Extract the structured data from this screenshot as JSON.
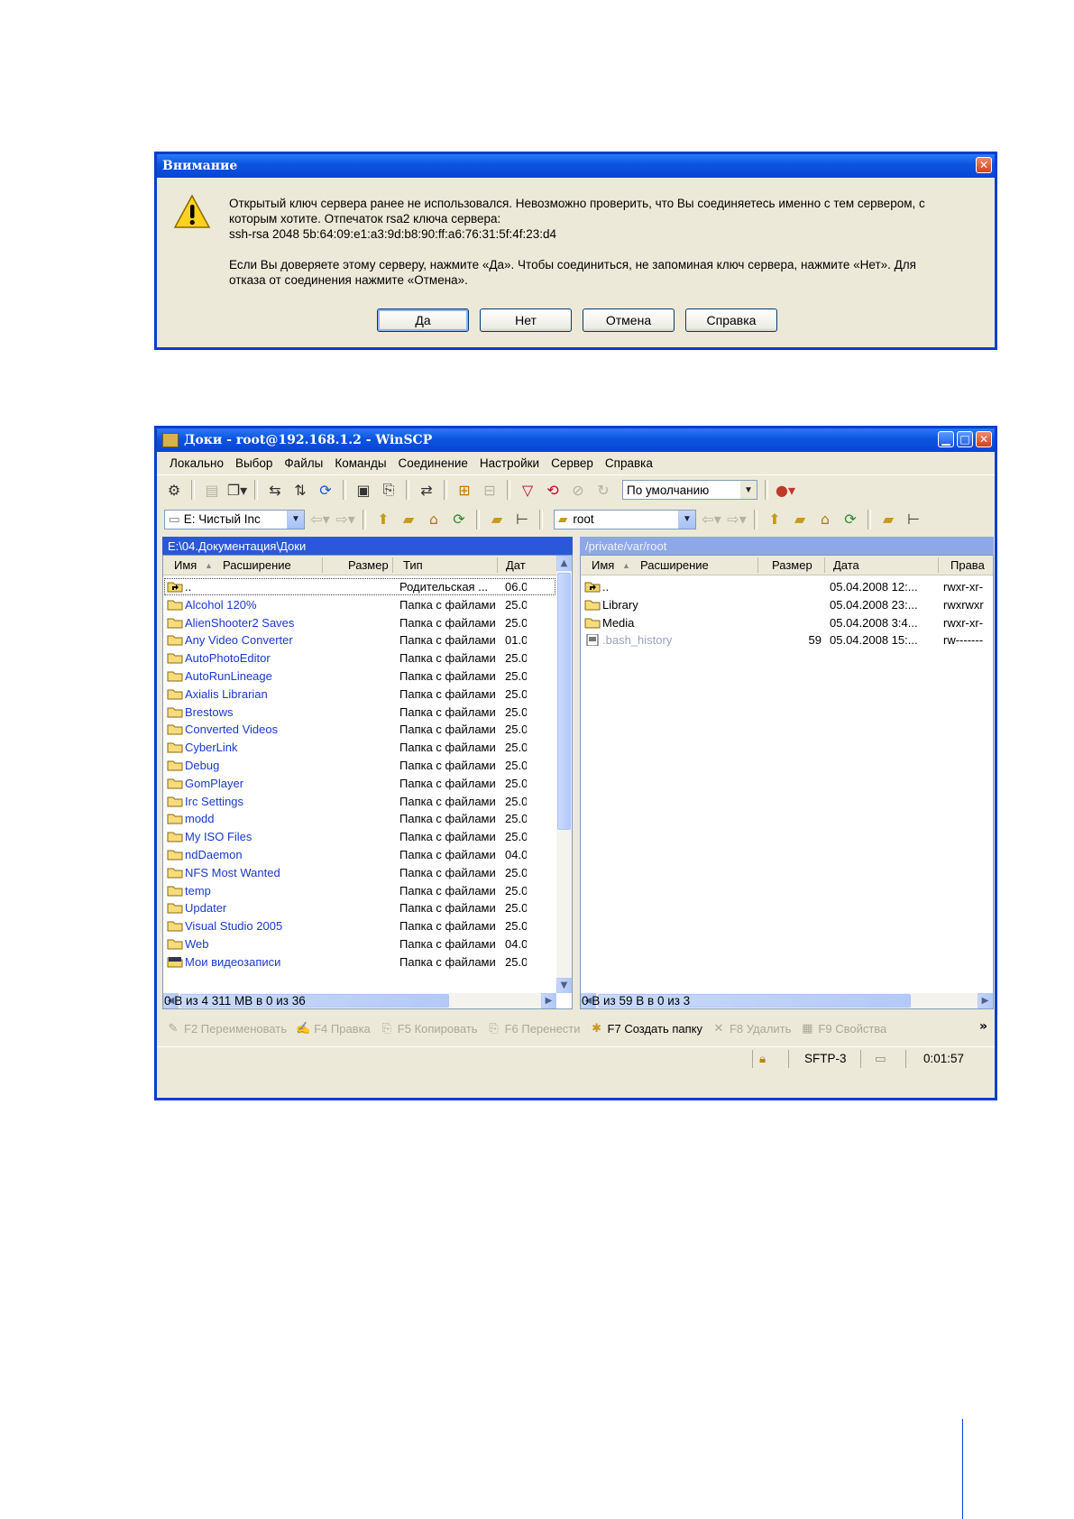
{
  "dialog": {
    "title": "Внимание",
    "message_line1": "Открытый ключ сервера ранее не использовался. Невозможно проверить, что Вы соединяетесь именно с тем сервером, с",
    "message_line2": "которым хотите. Отпечаток rsa2 ключа сервера:",
    "message_line3": "ssh-rsa 2048 5b:64:09:e1:a3:9d:b8:90:ff:a6:76:31:5f:4f:23:d4",
    "message_line4": "Если Вы доверяете этому серверу, нажмите «Да». Чтобы соединиться, не запоминая ключ сервера, нажмите «Нет». Для",
    "message_line5": "отказа от соединения нажмите «Отмена».",
    "buttons": [
      "Да",
      "Нет",
      "Отмена",
      "Справка"
    ]
  },
  "main": {
    "title": "Доки - root@192.168.1.2 - WinSCP",
    "menu": [
      "Локально",
      "Выбор",
      "Файлы",
      "Команды",
      "Соединение",
      "Настройки",
      "Сервер",
      "Справка"
    ],
    "preset_combo": "По умолчанию",
    "left_drive": "E: Чистый Inc",
    "remote_dir_combo": "root",
    "left_path": "E:\\04.Документация\\Доки",
    "right_path": "/private/var/root",
    "left_columns": [
      "Имя",
      "Расширение",
      "Размер",
      "Тип",
      "Дат"
    ],
    "right_columns": [
      "Имя",
      "Расширение",
      "Размер",
      "Дата",
      "Права"
    ],
    "left_files": [
      {
        "name": "..",
        "type": "Родительская ...",
        "date": "06.0"
      },
      {
        "name": "Alcohol 120%",
        "type": "Папка с файлами",
        "date": "25.0"
      },
      {
        "name": "AlienShooter2 Saves",
        "type": "Папка с файлами",
        "date": "25.0"
      },
      {
        "name": "Any Video Converter",
        "type": "Папка с файлами",
        "date": "01.0"
      },
      {
        "name": "AutoPhotoEditor",
        "type": "Папка с файлами",
        "date": "25.0"
      },
      {
        "name": "AutoRunLineage",
        "type": "Папка с файлами",
        "date": "25.0"
      },
      {
        "name": "Axialis Librarian",
        "type": "Папка с файлами",
        "date": "25.0"
      },
      {
        "name": "Brestows",
        "type": "Папка с файлами",
        "date": "25.0"
      },
      {
        "name": "Converted Videos",
        "type": "Папка с файлами",
        "date": "25.0"
      },
      {
        "name": "CyberLink",
        "type": "Папка с файлами",
        "date": "25.0"
      },
      {
        "name": "Debug",
        "type": "Папка с файлами",
        "date": "25.0"
      },
      {
        "name": "GomPlayer",
        "type": "Папка с файлами",
        "date": "25.0"
      },
      {
        "name": "Irc Settings",
        "type": "Папка с файлами",
        "date": "25.0"
      },
      {
        "name": "modd",
        "type": "Папка с файлами",
        "date": "25.0"
      },
      {
        "name": "My ISO Files",
        "type": "Папка с файлами",
        "date": "25.0"
      },
      {
        "name": "ndDaemon",
        "type": "Папка с файлами",
        "date": "04.0"
      },
      {
        "name": "NFS Most Wanted",
        "type": "Папка с файлами",
        "date": "25.0"
      },
      {
        "name": "temp",
        "type": "Папка с файлами",
        "date": "25.0"
      },
      {
        "name": "Updater",
        "type": "Папка с файлами",
        "date": "25.0"
      },
      {
        "name": "Visual Studio 2005",
        "type": "Папка с файлами",
        "date": "25.0"
      },
      {
        "name": "Web",
        "type": "Папка с файлами",
        "date": "04.0"
      },
      {
        "name": "Мои видеозаписи",
        "type": "Папка с файлами",
        "date": "25.0"
      }
    ],
    "right_files": [
      {
        "name": "..",
        "size": "",
        "date": "05.04.2008 12:...",
        "rights": "rwxr-xr-"
      },
      {
        "name": "Library",
        "size": "",
        "date": "05.04.2008 23:...",
        "rights": "rwxrwxr"
      },
      {
        "name": "Media",
        "size": "",
        "date": "05.04.2008 3:4...",
        "rights": "rwxr-xr-"
      },
      {
        "name": ".bash_history",
        "size": "59",
        "date": "05.04.2008 15:...",
        "rights": "rw-------"
      }
    ],
    "left_status": "0 B из 4 311 MB в 0 из 36",
    "right_status": "0 B из 59 B в 0 из 3",
    "fkeys": [
      "F2 Переименовать",
      "F4 Правка",
      "F5 Копировать",
      "F6 Перенести",
      "F7 Создать папку",
      "F8 Удалить",
      "F9 Свойства"
    ],
    "protocol": "SFTP-3",
    "elapsed": "0:01:57"
  }
}
